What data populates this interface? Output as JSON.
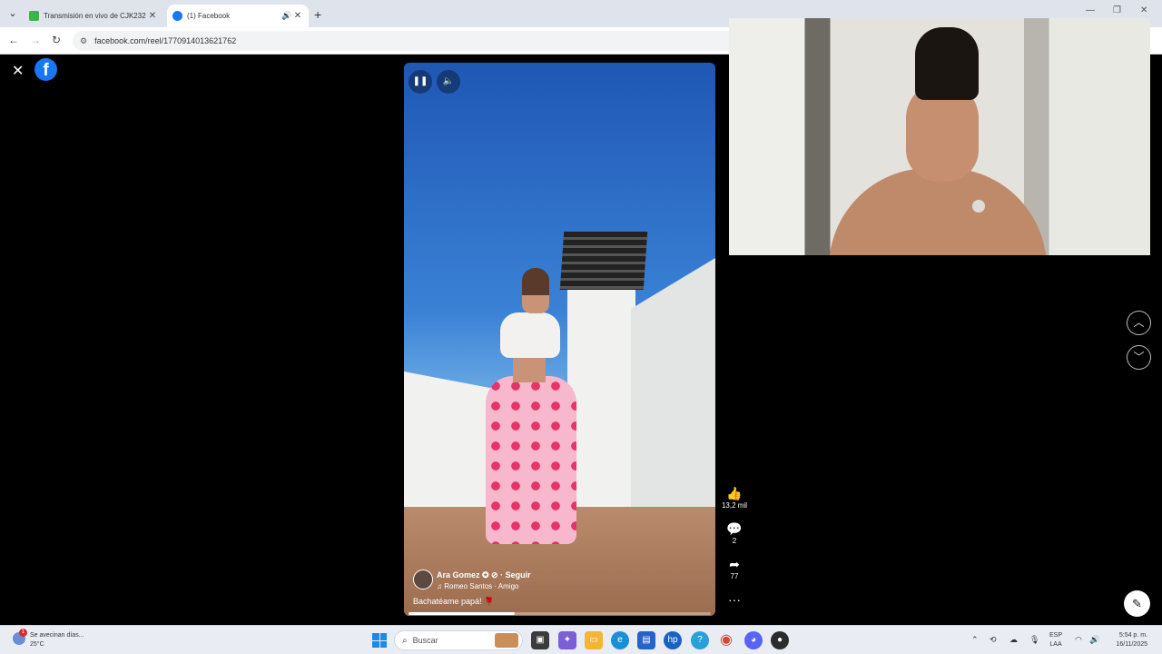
{
  "browser": {
    "tabs": [
      {
        "label": "Transmisión en vivo de CJK232",
        "favicon_color": "#39b54a"
      },
      {
        "label": "(1) Facebook",
        "favicon_color": "#1877f2"
      }
    ],
    "url": "facebook.com/reel/1770914013621762"
  },
  "reel": {
    "author": "Ara Gomez ✪ ⊘ · Seguir",
    "music": "♫ Romeo Santos · Amigo",
    "caption": "Bachatéame papá! 🌹",
    "progress": 0.35,
    "likes": "13,2 mil",
    "comments": "2",
    "shares": "77"
  },
  "taskbar": {
    "weather_text": "Se avecinan días...",
    "weather_temp": "25°C",
    "weather_badge": "1",
    "search_placeholder": "Buscar",
    "lang_top": "ESP",
    "lang_bottom": "LAA",
    "time": "5:54 p. m.",
    "date": "16/11/2025"
  },
  "icons": {
    "close": "close-icon",
    "logo": "facebook-logo-icon",
    "pause": "pause-icon",
    "volume": "volume-icon",
    "like": "thumbs-up-icon",
    "comment": "comment-icon",
    "share": "share-icon",
    "more": "more-icon",
    "up": "chevron-up-icon",
    "down": "chevron-down-icon",
    "edit": "edit-icon"
  }
}
